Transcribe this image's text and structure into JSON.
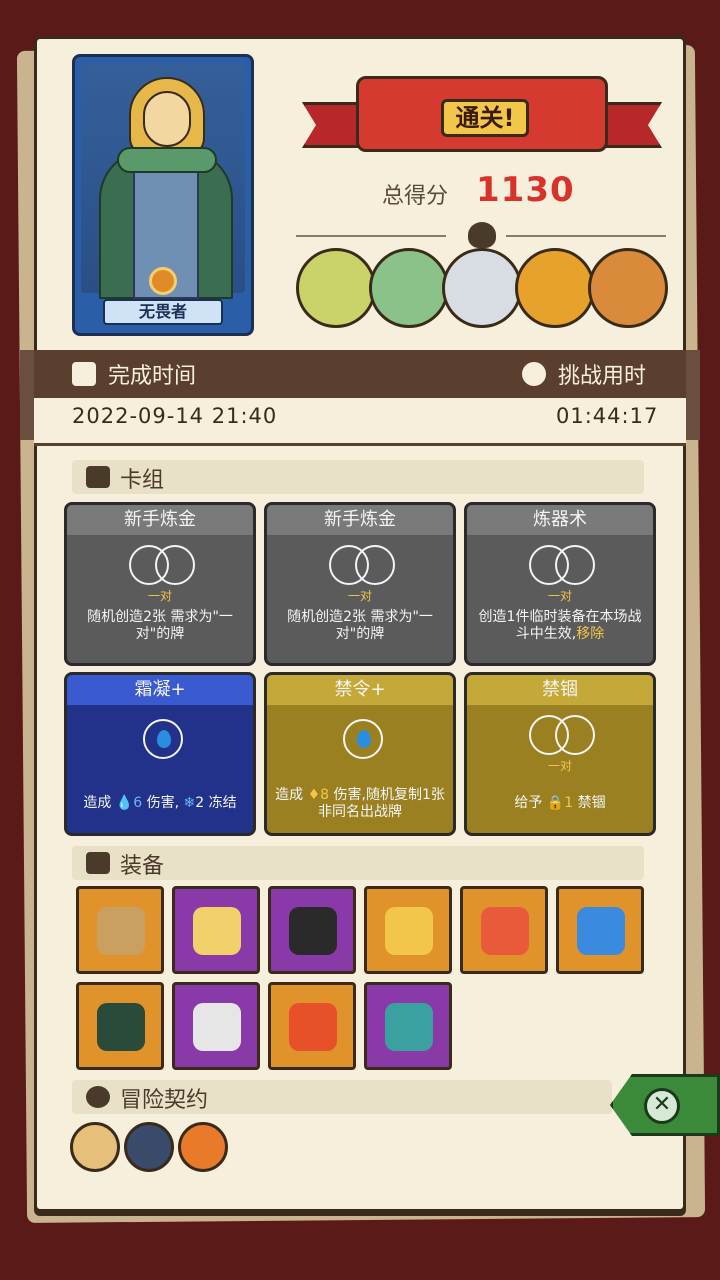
{
  "hero": {
    "name": "无畏者"
  },
  "banner": {
    "title": "通关!"
  },
  "score": {
    "label": "总得分",
    "value": "1130"
  },
  "bosses": [
    {
      "name": "boss-skeleton-dino",
      "color": "#c9d36a"
    },
    {
      "name": "boss-green-dragon",
      "color": "#8ac28a"
    },
    {
      "name": "boss-yeti",
      "color": "#d7dde3"
    },
    {
      "name": "boss-pumpkin",
      "color": "#e6a22a"
    },
    {
      "name": "boss-crystal-golem",
      "color": "#d98a3a"
    }
  ],
  "time": {
    "finish_label": "完成时间",
    "finish_value": "2022-09-14 21:40",
    "duration_label": "挑战用时",
    "duration_value": "01:44:17"
  },
  "deck": {
    "label": "卡组",
    "cards": [
      {
        "title": "新手炼金",
        "tag": "一对",
        "desc": "随机创造2张 需求为\"一对\"的牌",
        "style": "grey"
      },
      {
        "title": "新手炼金",
        "tag": "一对",
        "desc": "随机创造2张 需求为\"一对\"的牌",
        "style": "grey"
      },
      {
        "title": "炼器术",
        "tag": "一对",
        "desc_a": "创造1件临时装备在本场战斗中生效,",
        "desc_hl": "移除",
        "style": "grey"
      },
      {
        "title": "霜凝+",
        "desc_a": "造成",
        "desc_v1": "6",
        "desc_b": "伤害,",
        "desc_v2": "2",
        "desc_c": "冻结",
        "style": "blue"
      },
      {
        "title": "禁令+",
        "desc_a": "造成",
        "desc_v1": "8",
        "desc_b": "伤害,随机复制1张非同名出战牌",
        "style": "gold"
      },
      {
        "title": "禁锢",
        "tag": "一对",
        "desc_a": "给予",
        "desc_v1": "1",
        "desc_b": "禁锢",
        "style": "gold"
      }
    ]
  },
  "equipment": {
    "label": "装备",
    "items": [
      {
        "name": "money-bag-icon",
        "bg": "orange",
        "art": "#c9a060"
      },
      {
        "name": "cheese-icon",
        "bg": "purple",
        "art": "#f2d06a"
      },
      {
        "name": "dark-shard-icon",
        "bg": "purple",
        "art": "#2a2a2a"
      },
      {
        "name": "crown-icon",
        "bg": "orange",
        "art": "#f2c64a"
      },
      {
        "name": "ring-icon",
        "bg": "orange",
        "art": "#e85a3a"
      },
      {
        "name": "blue-slime-icon",
        "bg": "orange",
        "art": "#3a8ae0"
      },
      {
        "name": "horn-icon",
        "bg": "orange",
        "art": "#2a4a3a"
      },
      {
        "name": "mirror-icon",
        "bg": "purple",
        "art": "#e6e6e6"
      },
      {
        "name": "flame-feather-icon",
        "bg": "orange",
        "art": "#e8502a"
      },
      {
        "name": "demon-mask-icon",
        "bg": "purple",
        "art": "#3aa0a0"
      }
    ]
  },
  "contract": {
    "label": "冒险契约",
    "items": [
      {
        "name": "scroll-icon",
        "color": "#e6c07a"
      },
      {
        "name": "armor-box-icon",
        "color": "#3a4a6a"
      },
      {
        "name": "explosion-icon",
        "color": "#e87a2a"
      }
    ]
  },
  "close": {
    "label": "✕"
  }
}
